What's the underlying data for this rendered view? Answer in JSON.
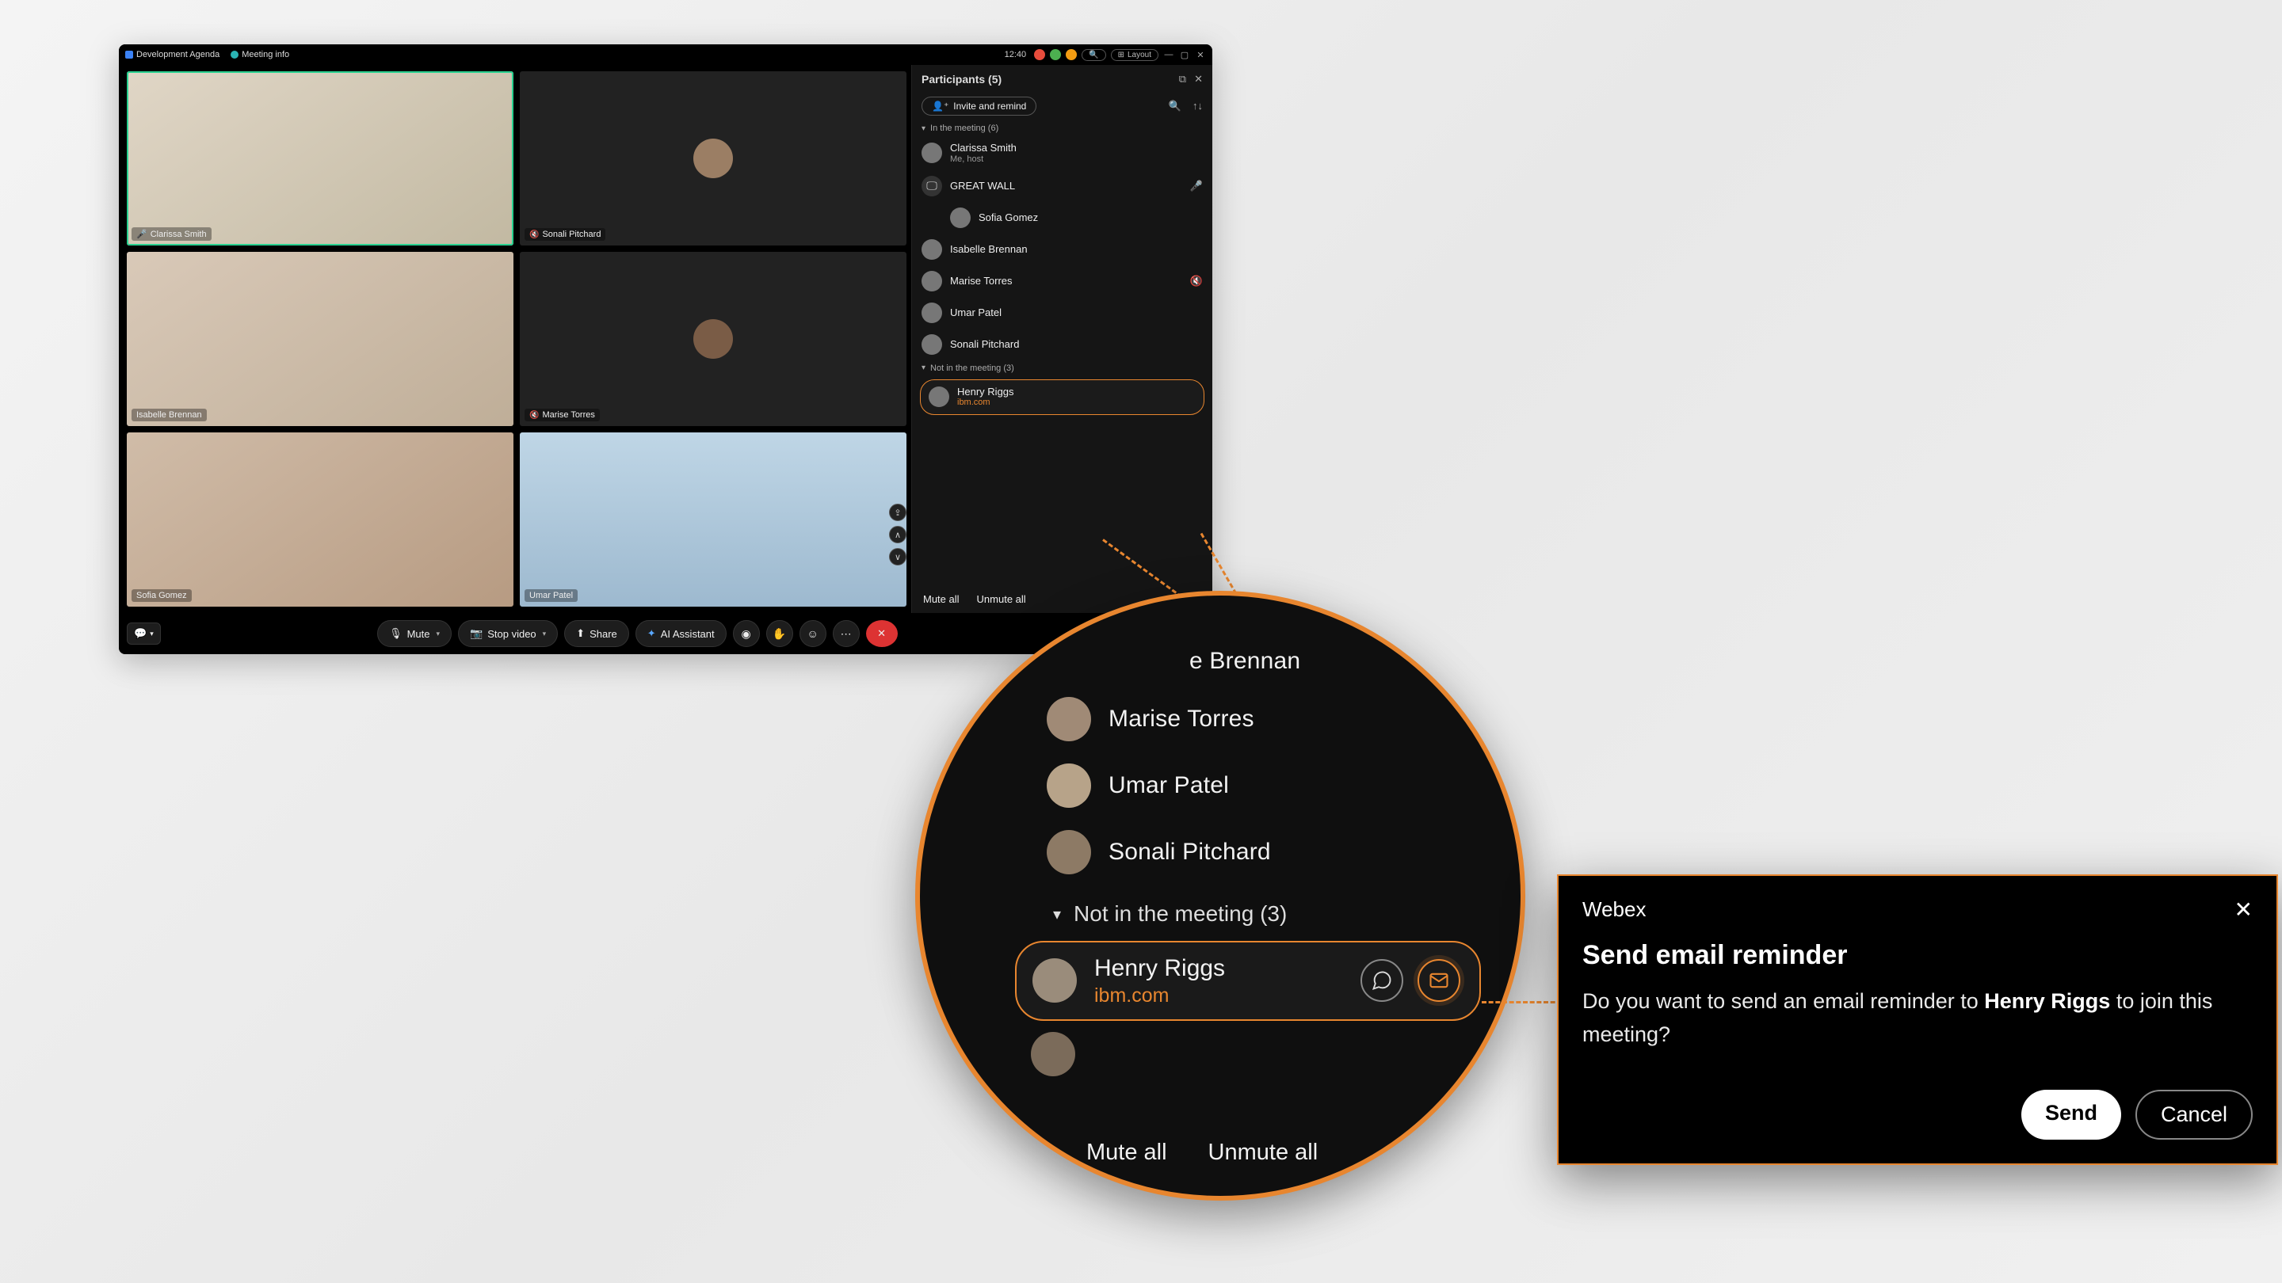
{
  "titlebar": {
    "agenda": "Development Agenda",
    "meeting_info": "Meeting info",
    "time": "12:40",
    "layout": "Layout"
  },
  "tiles": [
    {
      "name": "Clarissa Smith",
      "active": true
    },
    {
      "name": "Sonali Pitchard",
      "muted": true
    },
    {
      "name": "Isabelle Brennan"
    },
    {
      "name": "Marise Torres",
      "muted": true
    },
    {
      "name": "Sofia Gomez"
    },
    {
      "name": "Umar Patel"
    }
  ],
  "participants": {
    "title": "Participants (5)",
    "invite_label": "Invite and remind",
    "in_meeting_header": "In the meeting (6)",
    "not_in_meeting_header": "Not in the meeting (3)",
    "in_meeting": [
      {
        "name": "Clarissa Smith",
        "sub": "Me, host"
      },
      {
        "name": "GREAT WALL",
        "device": true,
        "mic": "green"
      },
      {
        "name": "Sofia Gomez"
      },
      {
        "name": "Isabelle Brennan"
      },
      {
        "name": "Marise Torres",
        "mic": "red"
      },
      {
        "name": "Umar Patel"
      },
      {
        "name": "Sonali Pitchard"
      }
    ],
    "highlighted": {
      "name": "Henry Riggs",
      "sub": "ibm.com"
    },
    "mute_all": "Mute all",
    "unmute_all": "Unmute all"
  },
  "controls": {
    "mute": "Mute",
    "stop_video": "Stop video",
    "share": "Share",
    "ai_assistant": "AI Assistant"
  },
  "zoom": {
    "rows": [
      "e Brennan",
      "Marise Torres",
      "Umar Patel",
      "Sonali Pitchard"
    ],
    "section": "Not in the meeting (3)",
    "hl_name": "Henry Riggs",
    "hl_sub": "ibm.com",
    "mute_all": "Mute all",
    "unmute_all": "Unmute all"
  },
  "dialog": {
    "app": "Webex",
    "title": "Send email reminder",
    "body_pre": "Do you want to send an email reminder to ",
    "body_name": "Henry Riggs",
    "body_post": " to join this meeting?",
    "send": "Send",
    "cancel": "Cancel"
  }
}
